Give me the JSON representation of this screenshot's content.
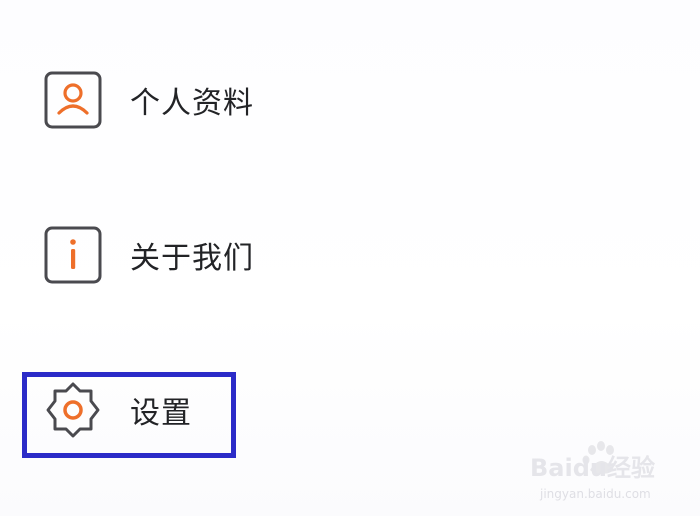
{
  "menu": {
    "items": [
      {
        "label": "个人资料",
        "icon": "user-profile-icon"
      },
      {
        "label": "关于我们",
        "icon": "info-icon"
      },
      {
        "label": "设置",
        "icon": "gear-icon"
      }
    ]
  },
  "highlight": {
    "target": "设置",
    "color": "#2b2bc8"
  },
  "colors": {
    "accent": "#ee6f2a",
    "icon_stroke": "#4a4a4f",
    "text": "#222326"
  },
  "watermark": {
    "brand": "Baidu经验",
    "url": "jingyan.baidu.com"
  }
}
